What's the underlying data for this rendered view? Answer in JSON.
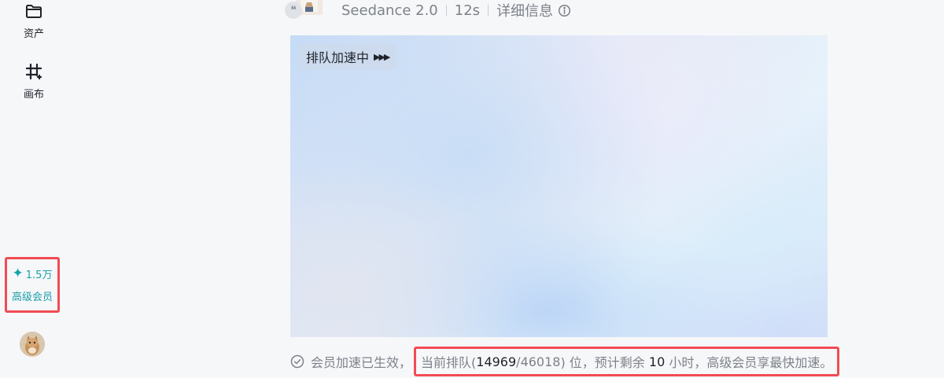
{
  "sidebar": {
    "items": [
      {
        "label": "资产",
        "icon": "folder-icon"
      },
      {
        "label": "画布",
        "icon": "canvas-grid-icon"
      }
    ],
    "membership": {
      "credits": "1.5万",
      "tier_label": "高级会员",
      "icon": "sparkle-icon",
      "accent_color": "#1a9fa8"
    },
    "avatar": {
      "icon": "user-avatar"
    }
  },
  "header": {
    "model": "Seedance 2.0",
    "duration": "12s",
    "detail_label": "详细信息",
    "quote_glyph": "❝"
  },
  "preview": {
    "queue_badge": "排队加速中",
    "arrows": "▶▶▶"
  },
  "status": {
    "prefix": "会员加速已生效，",
    "queue_text_before": "当前排队(",
    "queue_position": "14969",
    "queue_separator": "/",
    "queue_total": "46018",
    "queue_text_after": ") 位，预计剩余 ",
    "remaining_hours": "10",
    "remaining_suffix": " 小时，高级会员享最快加速。"
  },
  "colors": {
    "highlight_border": "#f24b53",
    "muted_text": "#7d8289",
    "background": "#f6f7f9"
  }
}
